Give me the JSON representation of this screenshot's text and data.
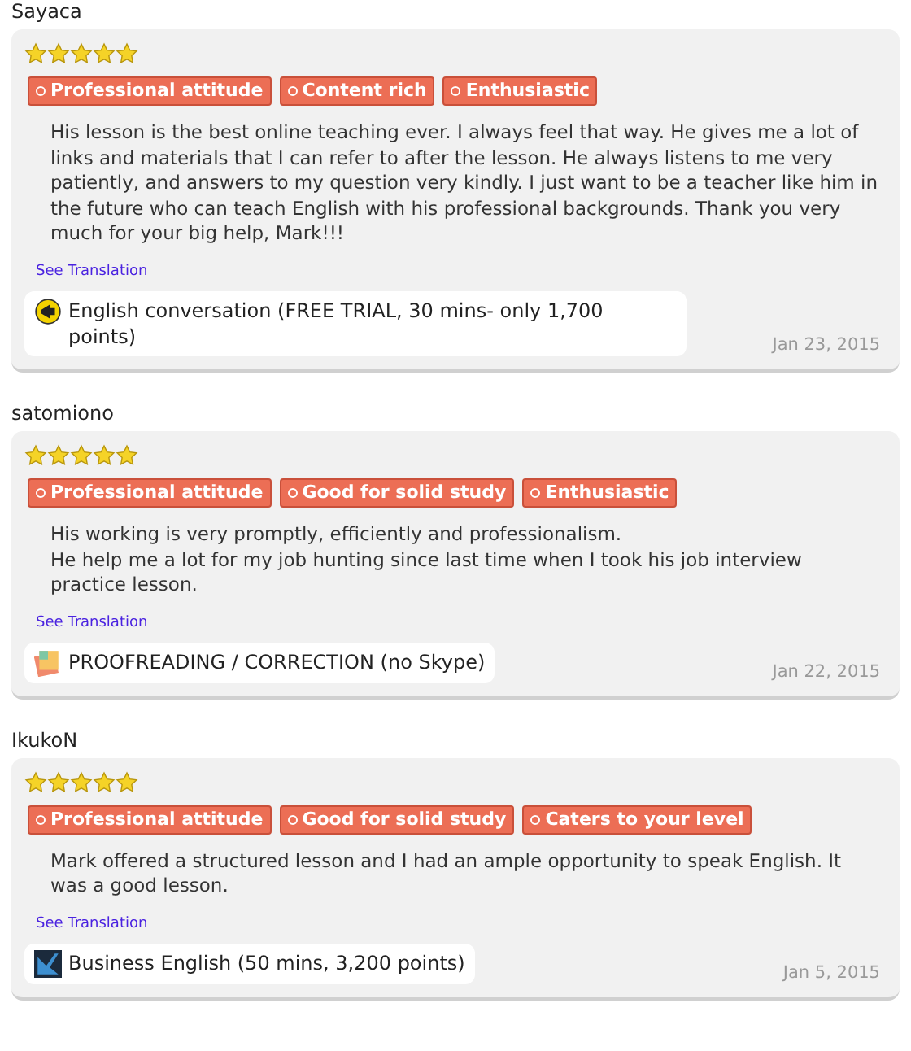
{
  "reviews": [
    {
      "user": "Sayaca",
      "stars": 5,
      "tags": [
        "Professional attitude",
        "Content rich",
        "Enthusiastic"
      ],
      "text": "His lesson is the best online teaching ever. I always feel that way. He gives me a lot of links and materials that I can refer to after the lesson. He always listens to me very patiently, and answers to my question very kindly. I just want to be a teacher like him in the future who can teach English with his professional backgrounds. Thank you very much for your big help, Mark!!!",
      "translation_link": "See Translation",
      "course": "English conversation (FREE TRIAL, 30 mins- only 1,700 points)",
      "date": "Jan 23, 2015"
    },
    {
      "user": "satomiono",
      "stars": 5,
      "tags": [
        "Professional attitude",
        "Good for solid study",
        "Enthusiastic"
      ],
      "text": "His working is very promptly, efficiently and professionalism.\nHe help me a lot for my job hunting since last time when I took his job interview practice lesson.",
      "translation_link": "See Translation",
      "course": "PROOFREADING / CORRECTION (no Skype)",
      "date": "Jan 22, 2015"
    },
    {
      "user": "IkukoN",
      "stars": 5,
      "tags": [
        "Professional attitude",
        "Good for solid study",
        "Caters to your level"
      ],
      "text": "Mark offered a structured lesson and I had an ample opportunity to speak English. It was a good lesson.",
      "translation_link": "See Translation",
      "course": "Business English (50 mins, 3,200 points)",
      "date": "Jan 5, 2015"
    }
  ]
}
